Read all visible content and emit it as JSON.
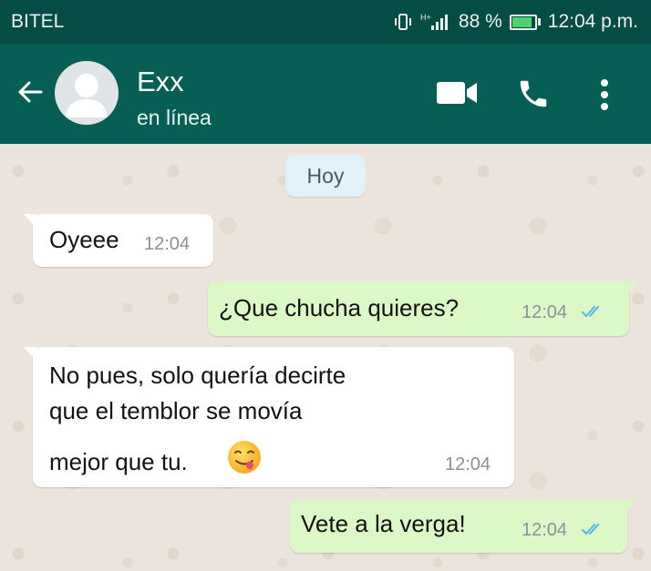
{
  "status_bar": {
    "carrier": "BITEL",
    "network": "H+",
    "battery": "88 %",
    "battery_level": 0.88,
    "time": "12:04 p.m.",
    "icons": [
      "vibrate-icon",
      "signal-icon",
      "battery-icon"
    ]
  },
  "header": {
    "contact_name": "Exx",
    "contact_status": "en línea",
    "icons": [
      "back-arrow-icon",
      "avatar-placeholder-icon",
      "video-call-icon",
      "phone-call-icon",
      "more-options-icon"
    ]
  },
  "chat": {
    "date_label": "Hoy",
    "messages": [
      {
        "direction": "incoming",
        "lines": [
          "Oyeee"
        ],
        "time": "12:04"
      },
      {
        "direction": "outgoing",
        "lines": [
          "¿Que chucha quieres?"
        ],
        "time": "12:04",
        "status": "read"
      },
      {
        "direction": "incoming",
        "lines": [
          "No pues, solo quería decirte",
          "que el temblor se movía",
          "mejor que tu."
        ],
        "emoji": "savoring-face-emoji",
        "time": "12:04"
      },
      {
        "direction": "outgoing",
        "lines": [
          "Vete a la verga!"
        ],
        "time": "12:04",
        "status": "read"
      }
    ]
  },
  "colors": {
    "header": "#075e54",
    "status_bar": "#054d44",
    "incoming_bubble": "#ffffff",
    "outgoing_bubble": "#dcf8c6",
    "read_ticks": "#4fb6ec",
    "chat_background": "#ece5dd"
  }
}
